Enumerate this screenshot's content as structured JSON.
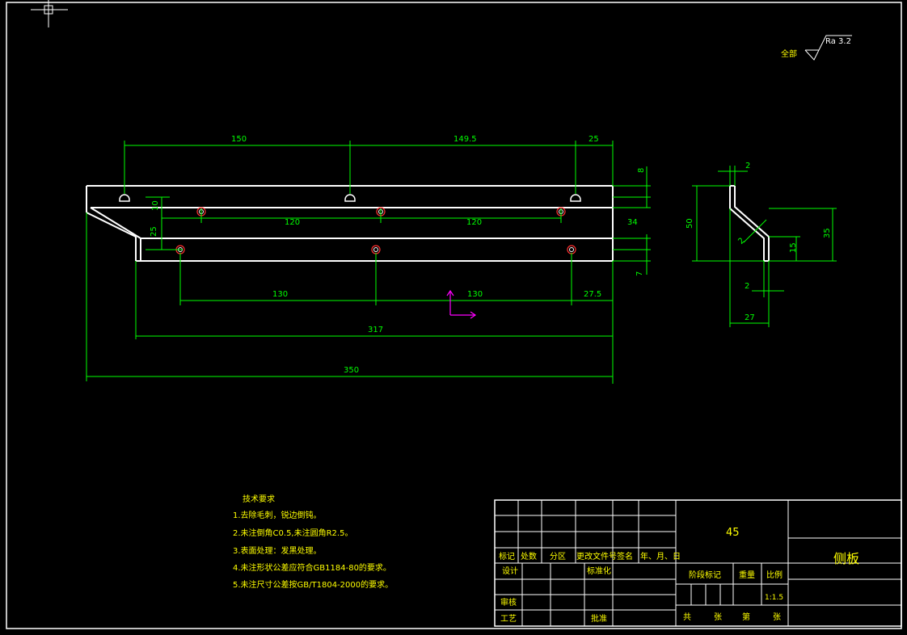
{
  "surface_finish": {
    "prefix": "全部",
    "value": "Ra 3.2"
  },
  "front_view": {
    "dims": {
      "d150": "150",
      "d149_5": "149.5",
      "d25": "25",
      "d8": "8",
      "d10": "10",
      "d25v": "25",
      "d120a": "120",
      "d120b": "120",
      "d34": "34",
      "d7": "7",
      "d130a": "130",
      "d130b": "130",
      "d27_5": "27.5",
      "d317": "317",
      "d350": "350"
    }
  },
  "side_view": {
    "dims": {
      "d2top": "2",
      "d50": "50",
      "d2diag": "2",
      "d15": "15",
      "d35": "35",
      "d2bot": "2",
      "d27": "27"
    }
  },
  "tech_req": {
    "title": "技术要求",
    "items": [
      "1.去除毛刺，锐边倒钝。",
      "2.未注倒角C0.5,未注圆角R2.5。",
      "3.表面处理：发黑处理。",
      "4.未注形状公差应符合GB1184-80的要求。",
      "5.未注尺寸公差按GB/T1804-2000的要求。"
    ]
  },
  "title_block": {
    "material": "45",
    "part_name": "侧板",
    "headers": [
      "标记",
      "处数",
      "分区",
      "更改文件号",
      "签名",
      "年、月、日"
    ],
    "design": "设计",
    "standardize": "标准化",
    "review": "审核",
    "process": "工艺",
    "approve": "批准",
    "stage_mark": "阶段标记",
    "weight": "重量",
    "scale_label": "比例",
    "scale_value": "1:1.5",
    "total": "共",
    "sheets": "张",
    "no": "第",
    "sheet2": "张"
  },
  "colors": {
    "line": "#ffffff",
    "dim": "#00ff00",
    "text": "#ffff00",
    "hole": "#ff3030",
    "ucs": "#ff00ff"
  }
}
